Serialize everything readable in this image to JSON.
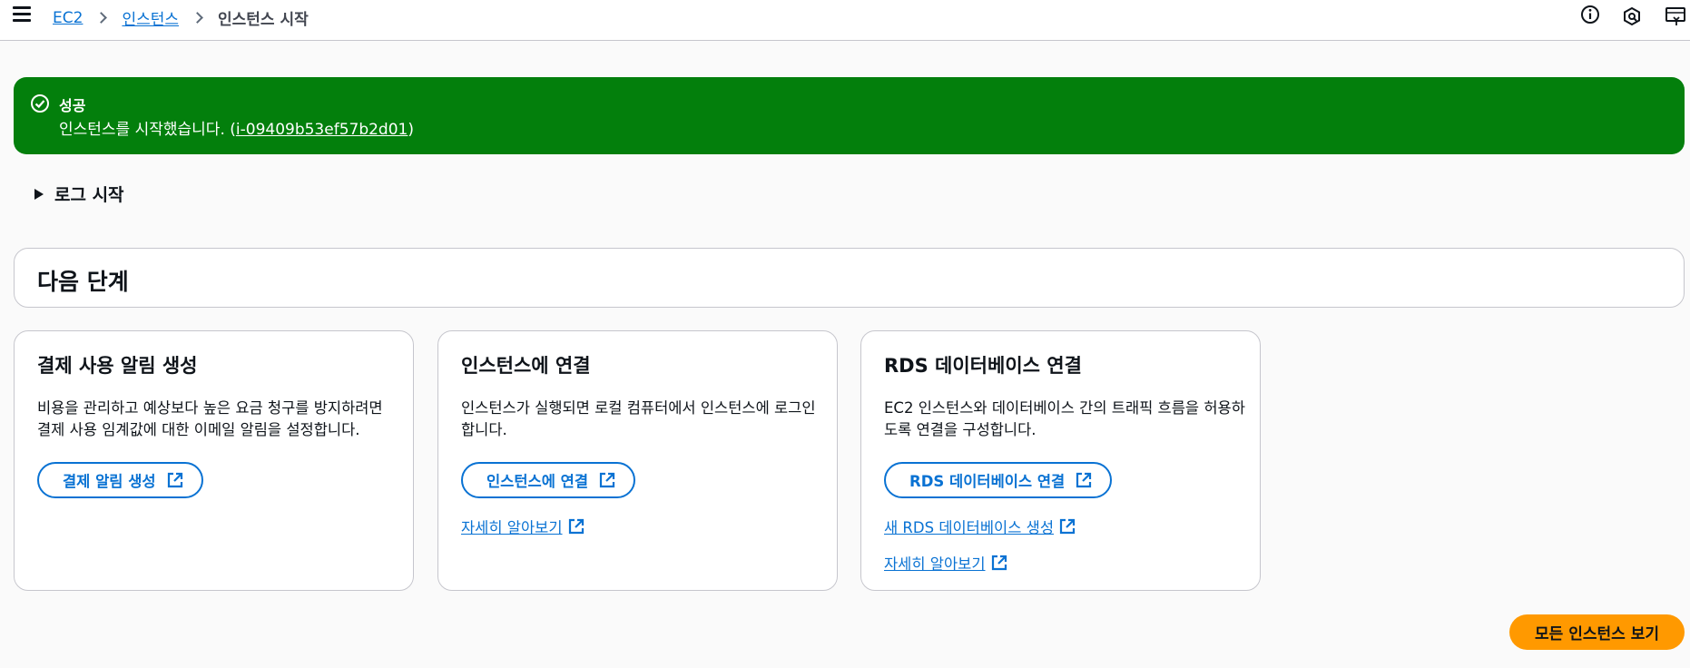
{
  "breadcrumb": {
    "items": [
      "EC2",
      "인스턴스"
    ],
    "current": "인스턴스 시작"
  },
  "flash": {
    "title": "성공",
    "message_prefix": "인스턴스를 시작했습니다. (",
    "instance_id": "i-09409b53ef57b2d01",
    "message_suffix": ")",
    "color": "#037f0c"
  },
  "expandable": {
    "label": "로그 시작"
  },
  "next_steps": {
    "title": "다음 단계"
  },
  "cards": [
    {
      "title": "결제 사용 알림 생성",
      "description": "비용을 관리하고 예상보다 높은 요금 청구를 방지하려면 결제 사용 임계값에 대한 이메일 알림을 설정합니다.",
      "button": "결제 알림 생성",
      "links": []
    },
    {
      "title": "인스턴스에 연결",
      "description": "인스턴스가 실행되면 로컬 컴퓨터에서 인스턴스에 로그인합니다.",
      "button": "인스턴스에 연결",
      "links": [
        "자세히 알아보기"
      ]
    },
    {
      "title": "RDS 데이터베이스 연결",
      "description": "EC2 인스턴스와 데이터베이스 간의 트래픽 흐름을 허용하도록 연결을 구성합니다.",
      "button": "RDS 데이터베이스 연결",
      "links": [
        "새 RDS 데이터베이스 생성",
        "자세히 알아보기"
      ]
    }
  ],
  "primary_action": {
    "label": "모든 인스턴스 보기",
    "color": "#ff9900"
  },
  "colors": {
    "link": "#0972d3",
    "border": "#c6c6cd"
  }
}
